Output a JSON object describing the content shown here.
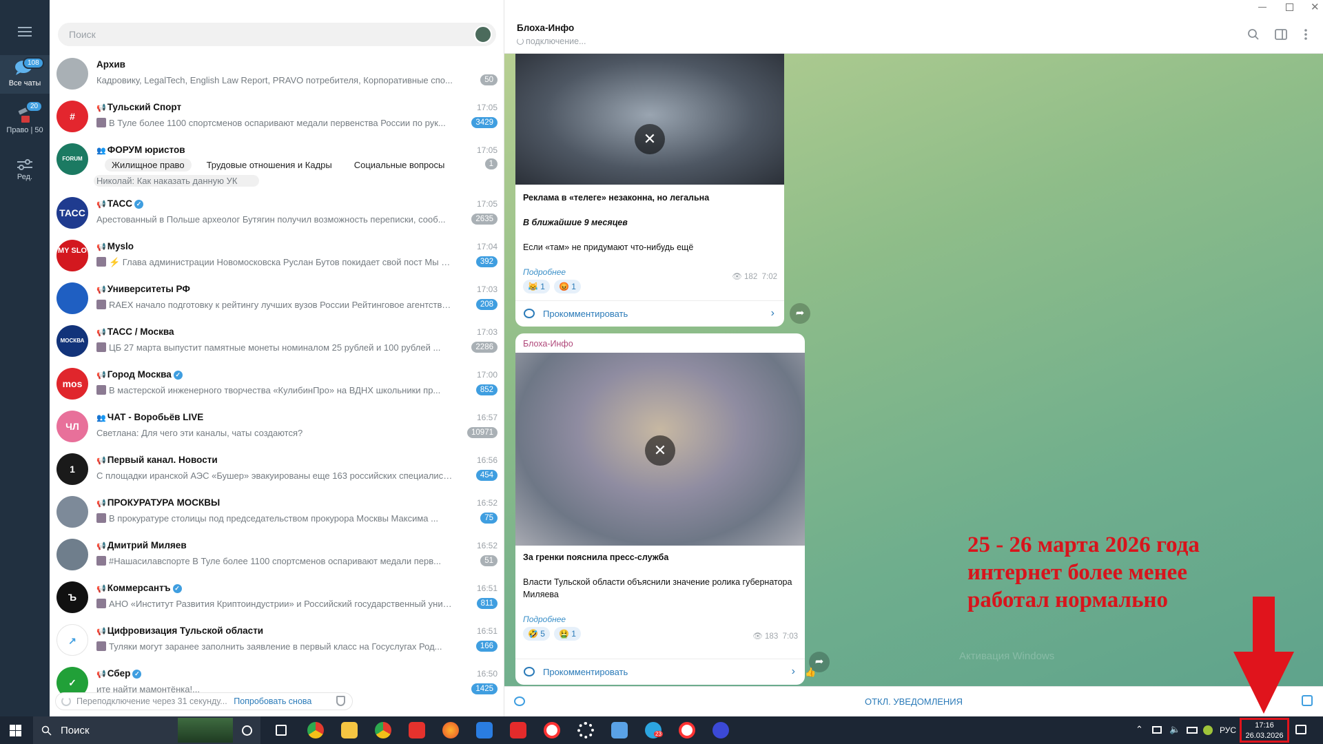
{
  "rail": {
    "all_chats_label": "Все чаты",
    "all_chats_badge": "108",
    "folder2_label": "Право | 50",
    "folder2_badge": "20",
    "edit_label": "Ред."
  },
  "search": {
    "placeholder": "Поиск"
  },
  "chats": [
    {
      "name": "Архив",
      "time": "",
      "preview": "Кадровику, LegalTech, English Law Report, PRAVO потребителя, Корпоративные спо...",
      "badge": "50",
      "muted": true,
      "avatar_text": "",
      "avatar_color": "#a9b0b5",
      "channel": false,
      "verified": false
    },
    {
      "name": "Тульский Спорт",
      "time": "17:05",
      "preview": "В Туле более 1100 спортсменов оспаривают медали первенства России по рук...",
      "badge": "3429",
      "muted": false,
      "avatar_text": "#",
      "avatar_color": "#e3262e",
      "channel": true,
      "verified": false
    },
    {
      "name": "ФОРУМ юристов",
      "time": "17:05",
      "preview": "Николай: Как наказать данную УК",
      "badge": "1",
      "muted": true,
      "avatar_text": "FORUM",
      "avatar_color": "#1b7a62",
      "channel": false,
      "verified": false
    },
    {
      "name": "ТАСС",
      "time": "17:05",
      "preview": "Арестованный в Польше археолог Бутягин получил возможность переписки, сооб...",
      "badge": "2635",
      "muted": true,
      "avatar_text": "ТАСС",
      "avatar_color": "#1f3b8f",
      "channel": true,
      "verified": true
    },
    {
      "name": "Myslo",
      "time": "17:04",
      "preview": "⚡ Глава администрации Новомосковска Руслан Бутов покидает свой пост     Мы в ...",
      "badge": "392",
      "muted": false,
      "avatar_text": "MY SLO",
      "avatar_color": "#d3181f",
      "channel": true,
      "verified": false
    },
    {
      "name": "Университеты РФ",
      "time": "17:03",
      "preview": "RAEX начало подготовку к рейтингу лучших вузов России  Рейтинговое агентство ...",
      "badge": "208",
      "muted": false,
      "avatar_text": "",
      "avatar_color": "#1f5fc2",
      "channel": true,
      "verified": false
    },
    {
      "name": "ТАСС / Москва",
      "time": "17:03",
      "preview": "ЦБ 27 марта выпустит памятные монеты номиналом 25 рублей и 100 рублей ...",
      "badge": "2286",
      "muted": true,
      "avatar_text": "МОСКВА",
      "avatar_color": "#12337a",
      "channel": true,
      "verified": false
    },
    {
      "name": "Город Москва",
      "time": "17:00",
      "preview": "В мастерской инженерного творчества «КулибинПро» на ВДНХ школьники пр...",
      "badge": "852",
      "muted": false,
      "avatar_text": "mos",
      "avatar_color": "#e0262c",
      "channel": true,
      "verified": true
    },
    {
      "name": "ЧАТ - Воробьёв LIVE",
      "time": "16:57",
      "preview": "Светлана: Для чего эти каналы, чаты создаются?",
      "badge": "10971",
      "muted": true,
      "avatar_text": "ЧЛ",
      "avatar_color": "#e8709a",
      "channel": false,
      "verified": false
    },
    {
      "name": "Первый канал. Новости",
      "time": "16:56",
      "preview": "С площадки иранской АЭС «Бушер» эвакуированы еще 163 российских специалиста. ...",
      "badge": "454",
      "muted": false,
      "avatar_text": "1",
      "avatar_color": "#1a1a1a",
      "channel": true,
      "verified": false
    },
    {
      "name": "ПРОКУРАТУРА МОСКВЫ",
      "time": "16:52",
      "preview": "В прокуратуре столицы под председательством прокурора Москвы Максима ...",
      "badge": "75",
      "muted": false,
      "avatar_text": "",
      "avatar_color": "#7d8a99",
      "channel": true,
      "verified": false
    },
    {
      "name": "Дмитрий Миляев",
      "time": "16:52",
      "preview": "#Нашасилавспорте  В Туле более 1100 спортсменов оспаривают медали перв...",
      "badge": "51",
      "muted": true,
      "avatar_text": "",
      "avatar_color": "#6f7e8c",
      "channel": true,
      "verified": false
    },
    {
      "name": "Коммерсантъ",
      "time": "16:51",
      "preview": "АНО «Институт Развития Криптоиндустрии» и Российский государственный униве...",
      "badge": "811",
      "muted": false,
      "avatar_text": "Ъ",
      "avatar_color": "#111111",
      "channel": true,
      "verified": true
    },
    {
      "name": "Цифровизация Тульской области",
      "time": "16:51",
      "preview": "Туляки могут заранее заполнить заявление в первый класс на Госуслугах  Род...",
      "badge": "166",
      "muted": false,
      "avatar_text": "↗",
      "avatar_color": "#ffffff",
      "channel": true,
      "verified": false
    },
    {
      "name": "Сбер",
      "time": "16:50",
      "preview": "ите найти мамонтёнка!...",
      "badge": "1425",
      "muted": false,
      "avatar_text": "✓",
      "avatar_color": "#21a038",
      "channel": true,
      "verified": true
    }
  ],
  "forum_tags": [
    "Жилищное право",
    "Трудовые отношения и Кадры",
    "Социальные вопросы"
  ],
  "reconnect": {
    "text": "Переподключение через 31 секунду...",
    "link": "Попробовать снова"
  },
  "chat": {
    "title": "Блоха-Инфо",
    "status": "подключение...",
    "messages": [
      {
        "title": "Реклама в «телеге» незаконна, но легальна",
        "line2": "В ближайшие 9 месяцев",
        "line3": "Если «там» не придумают что-нибудь ещё",
        "more": "Подробнее",
        "react1": "1",
        "react2": "1",
        "views": "182",
        "time": "7:02",
        "comment": "Прокомментировать"
      },
      {
        "author": "Блоха-Инфо",
        "title": "За гренки пояснила пресс-служба",
        "line2": "Власти Тульской области объяснили значение ролика губернатора Миляева",
        "more": "Подробнее",
        "react1": "5",
        "react2": "1",
        "views": "183",
        "time": "7:03",
        "comment": "Прокомментировать"
      }
    ],
    "mute_label": "ОТКЛ. УВЕДОМЛЕНИЯ"
  },
  "overlay_note": "25 - 26 марта 2026 года интернет более менее работал нормально",
  "watermark": "Активация Windows",
  "taskbar": {
    "search_label": "Поиск",
    "lang": "РУС",
    "time": "17:16",
    "date": "26.03.2026",
    "telegram_badge": "23"
  },
  "colors": {
    "accent": "#3f9ee0",
    "rail": "#213040",
    "annotation_red": "#e0141c"
  }
}
